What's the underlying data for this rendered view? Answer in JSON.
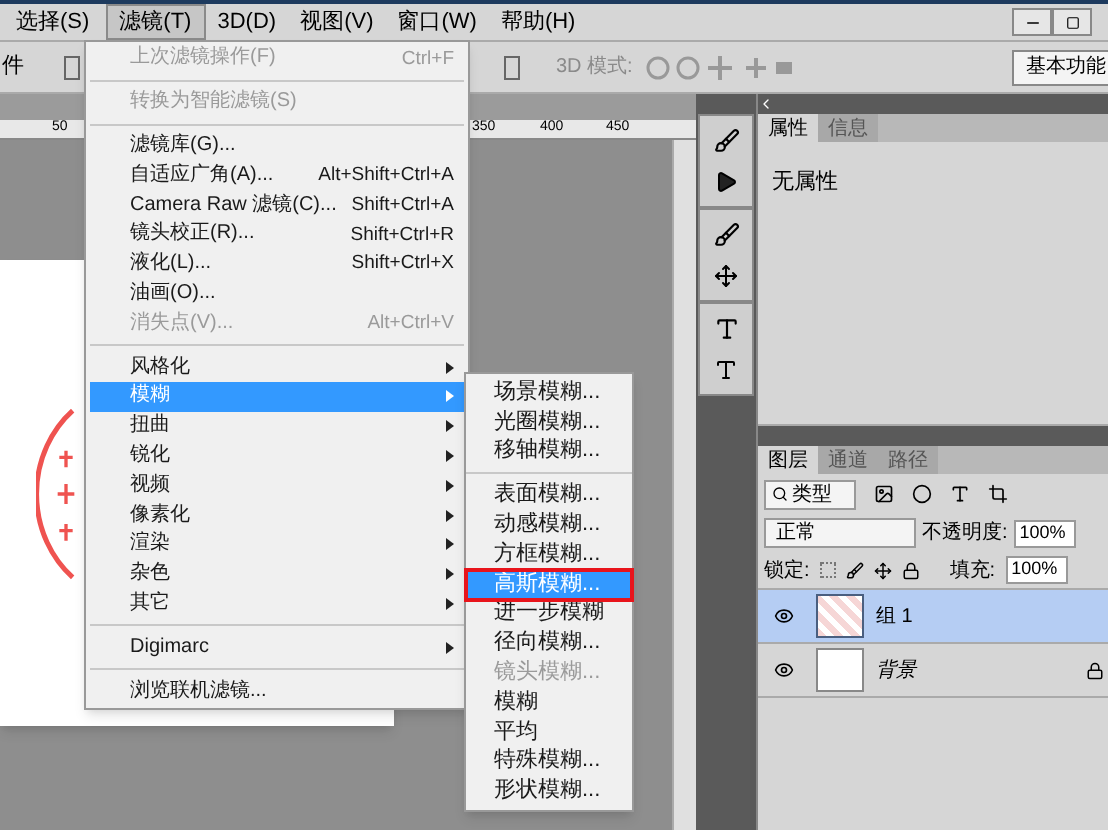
{
  "menubar": [
    {
      "label": "选择(S)",
      "selected": false
    },
    {
      "label": "滤镜(T)",
      "selected": true
    },
    {
      "label": "3D(D)",
      "selected": false
    },
    {
      "label": "视图(V)",
      "selected": false
    },
    {
      "label": "窗口(W)",
      "selected": false
    },
    {
      "label": "帮助(H)",
      "selected": false
    }
  ],
  "options_bar": {
    "cut_label": "件",
    "mode_label": "3D 模式:",
    "workspace_button": "基本功能"
  },
  "ruler_ticks": [
    "50",
    "350",
    "400",
    "450"
  ],
  "filter_menu": {
    "sections": [
      {
        "items": [
          {
            "label": "上次滤镜操作(F)",
            "shortcut": "Ctrl+F",
            "disabled": true,
            "submenu": false,
            "selected": false
          }
        ]
      },
      {
        "items": [
          {
            "label": "转换为智能滤镜(S)",
            "disabled": true,
            "submenu": false,
            "selected": false
          }
        ]
      },
      {
        "items": [
          {
            "label": "滤镜库(G)...",
            "disabled": false,
            "submenu": false,
            "selected": false
          },
          {
            "label": "自适应广角(A)...",
            "shortcut": "Alt+Shift+Ctrl+A",
            "disabled": false,
            "submenu": false,
            "selected": false
          },
          {
            "label": "Camera Raw 滤镜(C)...",
            "shortcut": "Shift+Ctrl+A",
            "disabled": false,
            "submenu": false,
            "selected": false
          },
          {
            "label": "镜头校正(R)...",
            "shortcut": "Shift+Ctrl+R",
            "disabled": false,
            "submenu": false,
            "selected": false
          },
          {
            "label": "液化(L)...",
            "shortcut": "Shift+Ctrl+X",
            "disabled": false,
            "submenu": false,
            "selected": false
          },
          {
            "label": "油画(O)...",
            "disabled": false,
            "submenu": false,
            "selected": false
          },
          {
            "label": "消失点(V)...",
            "shortcut": "Alt+Ctrl+V",
            "disabled": true,
            "submenu": false,
            "selected": false
          }
        ]
      },
      {
        "items": [
          {
            "label": "风格化",
            "disabled": false,
            "submenu": true,
            "selected": false
          },
          {
            "label": "模糊",
            "disabled": false,
            "submenu": true,
            "selected": true
          },
          {
            "label": "扭曲",
            "disabled": false,
            "submenu": true,
            "selected": false
          },
          {
            "label": "锐化",
            "disabled": false,
            "submenu": true,
            "selected": false
          },
          {
            "label": "视频",
            "disabled": false,
            "submenu": true,
            "selected": false
          },
          {
            "label": "像素化",
            "disabled": false,
            "submenu": true,
            "selected": false
          },
          {
            "label": "渲染",
            "disabled": false,
            "submenu": true,
            "selected": false
          },
          {
            "label": "杂色",
            "disabled": false,
            "submenu": true,
            "selected": false
          },
          {
            "label": "其它",
            "disabled": false,
            "submenu": true,
            "selected": false
          }
        ]
      },
      {
        "items": [
          {
            "label": "Digimarc",
            "disabled": false,
            "submenu": true,
            "selected": false
          }
        ]
      },
      {
        "items": [
          {
            "label": "浏览联机滤镜...",
            "disabled": false,
            "submenu": false,
            "selected": false
          }
        ]
      }
    ]
  },
  "blur_submenu": {
    "sections": [
      {
        "items": [
          {
            "label": "场景模糊...",
            "disabled": false,
            "selected": false,
            "outlined": false
          },
          {
            "label": "光圈模糊...",
            "disabled": false,
            "selected": false,
            "outlined": false
          },
          {
            "label": "移轴模糊...",
            "disabled": false,
            "selected": false,
            "outlined": false
          }
        ]
      },
      {
        "items": [
          {
            "label": "表面模糊...",
            "disabled": false,
            "selected": false,
            "outlined": false
          },
          {
            "label": "动感模糊...",
            "disabled": false,
            "selected": false,
            "outlined": false
          },
          {
            "label": "方框模糊...",
            "disabled": false,
            "selected": false,
            "outlined": false
          },
          {
            "label": "高斯模糊...",
            "disabled": false,
            "selected": true,
            "outlined": true
          },
          {
            "label": "进一步模糊",
            "disabled": false,
            "selected": false,
            "outlined": false
          },
          {
            "label": "径向模糊...",
            "disabled": false,
            "selected": false,
            "outlined": false
          },
          {
            "label": "镜头模糊...",
            "disabled": true,
            "selected": false,
            "outlined": false
          },
          {
            "label": "模糊",
            "disabled": false,
            "selected": false,
            "outlined": false
          },
          {
            "label": "平均",
            "disabled": false,
            "selected": false,
            "outlined": false
          },
          {
            "label": "特殊模糊...",
            "disabled": false,
            "selected": false,
            "outlined": false
          },
          {
            "label": "形状模糊...",
            "disabled": false,
            "selected": false,
            "outlined": false
          }
        ]
      }
    ]
  },
  "properties_panel": {
    "tabs": [
      {
        "label": "属性",
        "selected": true
      },
      {
        "label": "信息",
        "selected": false
      }
    ],
    "content": "无属性"
  },
  "layers_panel": {
    "tabs": [
      {
        "label": "图层",
        "selected": true
      },
      {
        "label": "通道",
        "selected": false
      },
      {
        "label": "路径",
        "selected": false
      }
    ],
    "filter_kind": "类型",
    "blend_mode": "正常",
    "opacity_label": "不透明度:",
    "opacity": "100%",
    "lock_label": "锁定:",
    "fill_label": "填充:",
    "fill": "100%",
    "layers": [
      {
        "name": "组 1",
        "selected": true,
        "locked": false,
        "kind": "group"
      },
      {
        "name": "背景",
        "selected": false,
        "locked": true,
        "kind": "background"
      }
    ]
  }
}
